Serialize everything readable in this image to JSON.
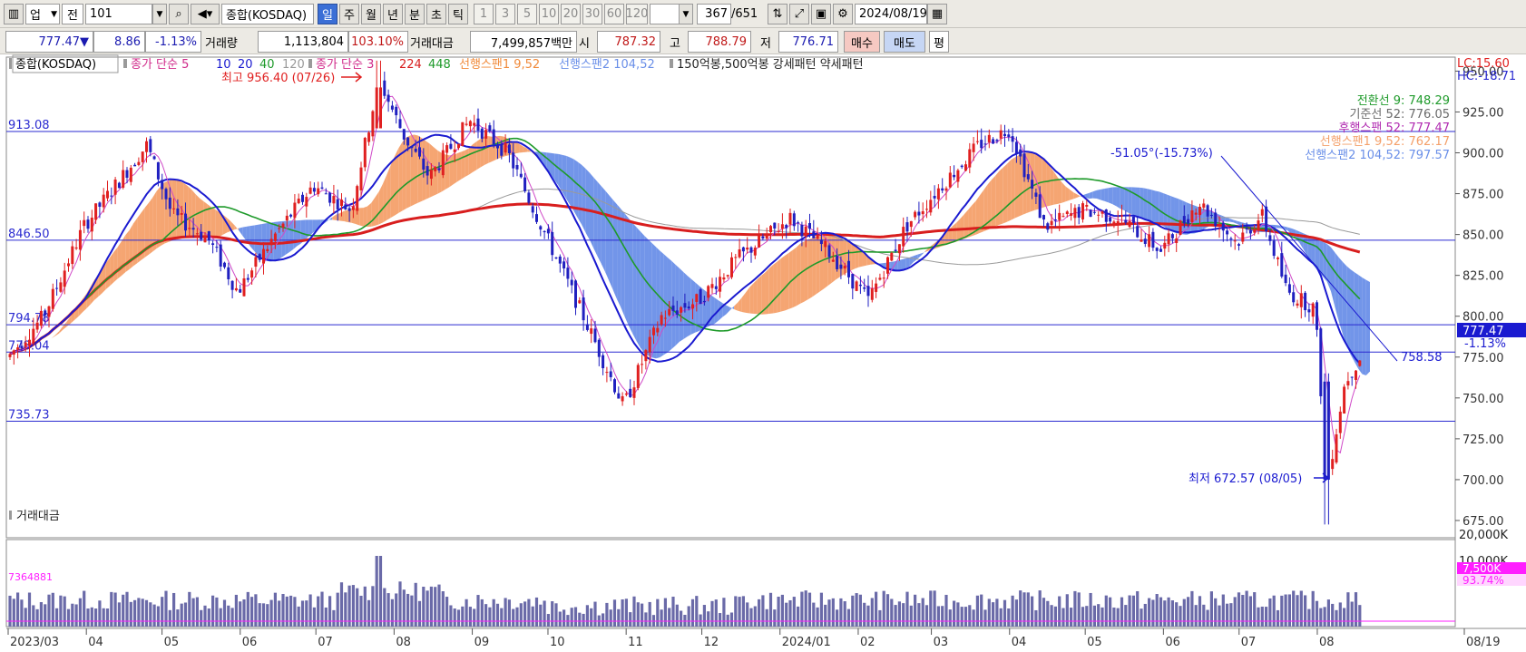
{
  "toolbar": {
    "market_label": "업",
    "prev_label": "전",
    "code": "101",
    "name": "종합(KOSDAQ)",
    "periods": [
      "일",
      "주",
      "월",
      "년",
      "분",
      "초",
      "틱"
    ],
    "minute_options": [
      "1",
      "3",
      "5",
      "10",
      "20",
      "30",
      "60",
      "120"
    ],
    "count": "367",
    "total": "/651",
    "date": "2024/08/19"
  },
  "quote": {
    "price": "777.47▼",
    "change": "8.86",
    "change_pct": "-1.13%",
    "volume_label": "거래량",
    "volume": "1,113,804",
    "volume_ratio": "103.10%",
    "amount_label": "거래대금",
    "amount": "7,499,857백만",
    "open_label": "시",
    "open": "787.32",
    "high_label": "고",
    "high": "788.79",
    "low_label": "저",
    "low": "776.71",
    "buy_label": "매수",
    "sell_label": "매도",
    "even_label": "평"
  },
  "legend": {
    "symbol": "종합(KOSDAQ)",
    "ma_label": "종가 단순 5",
    "ma_10": "10",
    "ma_20": "20",
    "ma_40": "40",
    "ma_120": "120",
    "ma2_label": "종가 단순 3",
    "ma2_224": "224",
    "ma2_448": "448",
    "span1": "선행스팬1 9,52",
    "span2": "선행스팬2 104,52",
    "pattern": "150억봉,500억봉 강세패턴  약세패턴"
  },
  "corner": {
    "lc": "LC:15.60",
    "hc": "HC:-18.71"
  },
  "ichimoku_values": [
    "전환선 9: 748.29",
    "기준선 52: 776.05",
    "후행스팬 52: 777.47",
    "선행스팬1 9,52: 762.17",
    "선행스팬2 104,52: 797.57"
  ],
  "annotations": {
    "high_text": "최고 956.40 (07/26)",
    "low_text": "최저 672.57 (08/05)",
    "trend_text": "-51.05°(-15.73%)",
    "trend_end_value": "758.58",
    "current_price": "777.47",
    "current_change": "-1.13%"
  },
  "volume_panel": {
    "title": "거래대금",
    "tag_value": "7,500K",
    "tag_pct": "93.74%",
    "left_label": "7364881"
  },
  "colors": {
    "up": "#e02020",
    "down": "#2020c0",
    "cloud_bull": "#f4a06a",
    "cloud_bear": "#6a8fe8",
    "hline": "#2a2ad0",
    "ma5": "#d04ac8",
    "ma20": "#1a1ad0",
    "ma60": "#1e9a2a",
    "ma224": "#d81e1e",
    "ma448": "#9a9a9a",
    "volume_bar": "#6a6aa8"
  },
  "chart_data": {
    "type": "candlestick",
    "title": "종합(KOSDAQ)",
    "y_ticks": [
      "950.00",
      "925.00",
      "900.00",
      "875.00",
      "850.00",
      "825.00",
      "800.00",
      "775.00",
      "750.00",
      "725.00",
      "700.00",
      "675.00"
    ],
    "y_range": [
      665,
      958
    ],
    "x_labels": [
      "2023/03",
      "04",
      "05",
      "06",
      "07",
      "08",
      "09",
      "10",
      "11",
      "12",
      "2024/01",
      "02",
      "03",
      "04",
      "05",
      "06",
      "07",
      "08",
      "08/19"
    ],
    "horizontal_lines": [
      {
        "value": 913.08,
        "label": "913.08"
      },
      {
        "value": 846.5,
        "label": "846.50"
      },
      {
        "value": 794.78,
        "label": "794.78"
      },
      {
        "value": 778.04,
        "label": "778.04"
      },
      {
        "value": 735.73,
        "label": "735.73"
      }
    ],
    "close_path": [
      [
        "2023-03-01",
        775
      ],
      [
        "2023-03-15",
        800
      ],
      [
        "2023-03-31",
        855
      ],
      [
        "2023-04-15",
        885
      ],
      [
        "2023-04-25",
        905
      ],
      [
        "2023-05-05",
        862
      ],
      [
        "2023-05-19",
        848
      ],
      [
        "2023-05-31",
        815
      ],
      [
        "2023-06-15",
        850
      ],
      [
        "2023-06-30",
        880
      ],
      [
        "2023-07-15",
        865
      ],
      [
        "2023-07-26",
        945
      ],
      [
        "2023-08-05",
        910
      ],
      [
        "2023-08-15",
        885
      ],
      [
        "2023-08-31",
        920
      ],
      [
        "2023-09-15",
        900
      ],
      [
        "2023-09-30",
        850
      ],
      [
        "2023-10-15",
        800
      ],
      [
        "2023-10-31",
        745
      ],
      [
        "2023-11-15",
        800
      ],
      [
        "2023-11-30",
        810
      ],
      [
        "2023-12-15",
        835
      ],
      [
        "2024-01-05",
        860
      ],
      [
        "2024-01-20",
        840
      ],
      [
        "2024-02-05",
        810
      ],
      [
        "2024-02-20",
        855
      ],
      [
        "2024-03-05",
        880
      ],
      [
        "2024-03-20",
        905
      ],
      [
        "2024-04-01",
        915
      ],
      [
        "2024-04-15",
        855
      ],
      [
        "2024-04-30",
        865
      ],
      [
        "2024-05-15",
        860
      ],
      [
        "2024-05-31",
        840
      ],
      [
        "2024-06-15",
        870
      ],
      [
        "2024-06-30",
        845
      ],
      [
        "2024-07-10",
        862
      ],
      [
        "2024-07-20",
        815
      ],
      [
        "2024-07-31",
        805
      ],
      [
        "2024-08-05",
        700
      ],
      [
        "2024-08-12",
        760
      ],
      [
        "2024-08-19",
        777.47
      ]
    ],
    "volume": {
      "y_ticks": [
        "20,000K",
        "10,000K"
      ]
    }
  }
}
